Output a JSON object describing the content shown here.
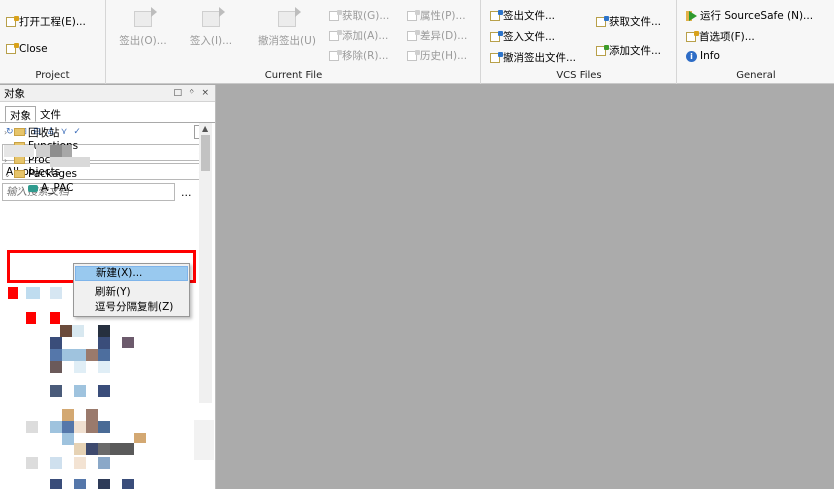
{
  "ribbon": {
    "project": {
      "caption": "Project",
      "open_project": "打开工程(E)...",
      "close": "Close"
    },
    "current_file": {
      "caption": "Current File",
      "checkout": "签出(O)...",
      "checkin": "签入(I)...",
      "undo_checkout": "撤消签出(U)",
      "get": "获取(G)...",
      "properties": "属性(P)...",
      "add": "添加(A)...",
      "diff": "差异(D)...",
      "remove": "移除(R)...",
      "history": "历史(H)..."
    },
    "vcs_files": {
      "caption": "VCS Files",
      "checkout_files": "签出文件...",
      "get_files": "获取文件...",
      "checkin_files": "签入文件...",
      "add_files": "添加文件...",
      "undo_checkout_files": "撤消签出文件..."
    },
    "general": {
      "caption": "General",
      "run_sourcesafe": "运行 SourceSafe (N)...",
      "preferences": "首选项(F)...",
      "info": "Info"
    }
  },
  "objects_pane": {
    "title": "对象",
    "controls": [
      "□",
      "ᛜ",
      "×"
    ],
    "tabs": [
      "对象",
      "文件"
    ],
    "filter_value": "All objects",
    "search_placeholder": "输入搜索文档",
    "search_more": "..."
  },
  "tree": {
    "items": [
      {
        "label": "回收站"
      },
      {
        "label": "Functions"
      },
      {
        "label": "Procedures"
      },
      {
        "label": "Packages"
      },
      {
        "label": "A_PAC"
      }
    ]
  },
  "context_menu": {
    "items": [
      "新建(X)...",
      "刷新(Y)",
      "逗号分隔复制(Z)"
    ]
  },
  "colors": {
    "highlight_box": "#ff0000",
    "menu_highlight": "#99c9ef",
    "workspace": "#ababab"
  }
}
